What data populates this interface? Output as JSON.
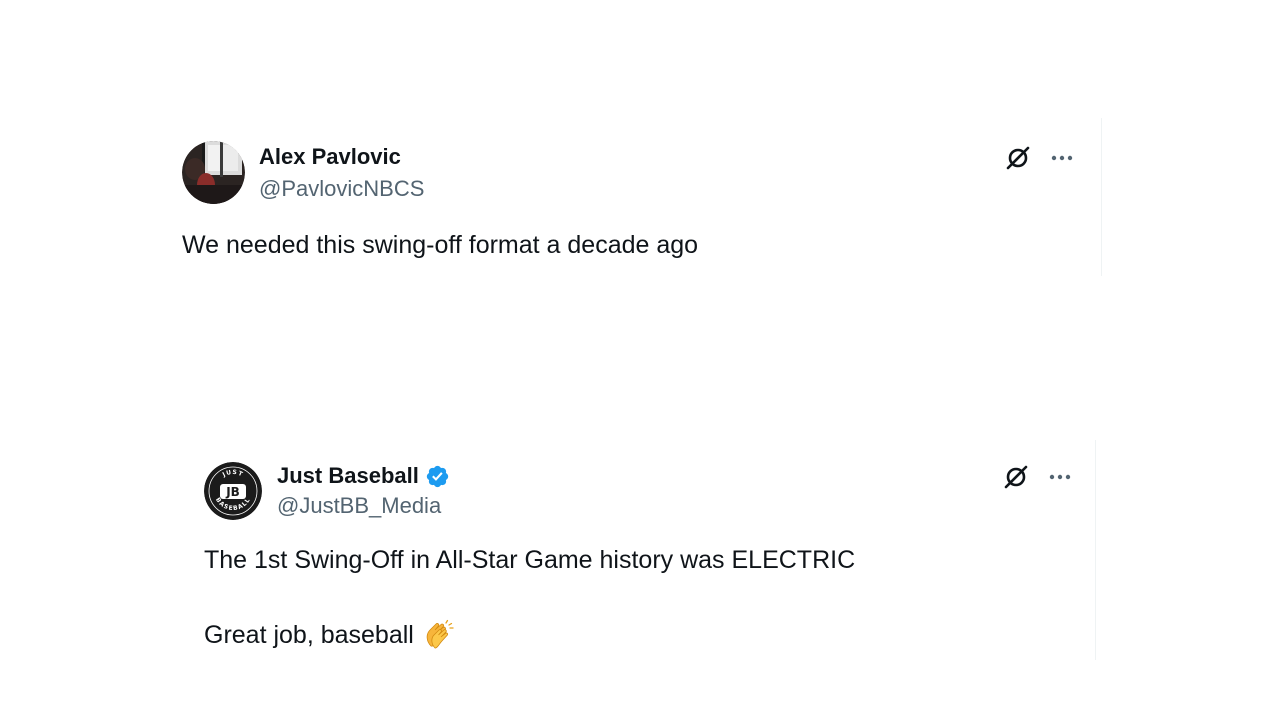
{
  "tweets": [
    {
      "display_name": "Alex Pavlovic",
      "handle": "@PavlovicNBCS",
      "verified": false,
      "text": "We needed this swing-off format a decade ago",
      "avatar": "profile-photo"
    },
    {
      "display_name": "Just Baseball",
      "handle": "@JustBB_Media",
      "verified": true,
      "text_line_1": "The 1st Swing-Off in All-Star Game history was ELECTRIC",
      "text_line_2": "Great job, baseball",
      "emoji": "clapping-hands",
      "avatar_logo": {
        "top_text": "JUST",
        "center_text": "JB",
        "bottom_text": "BASEBALL"
      }
    }
  ],
  "icons": {
    "grok": "grok-icon",
    "more": "more-options-icon",
    "verified": "verified-badge-icon"
  },
  "colors": {
    "text_primary": "#0f1419",
    "text_secondary": "#536471",
    "verified_blue": "#1d9bf0",
    "divider": "#eff3f4"
  }
}
